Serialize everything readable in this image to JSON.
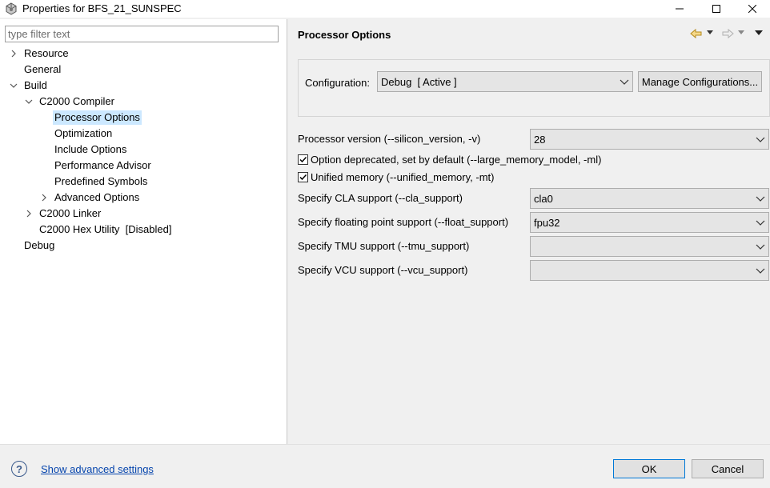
{
  "window": {
    "title": "Properties for BFS_21_SUNSPEC"
  },
  "filter": {
    "placeholder": "type filter text",
    "value": ""
  },
  "tree": [
    {
      "label": "Resource",
      "arrow": "right"
    },
    {
      "label": "General",
      "arrow": ""
    },
    {
      "label": "Build",
      "arrow": "down"
    },
    {
      "label": "C2000 Compiler",
      "arrow": "down"
    },
    {
      "label": "Processor Options",
      "arrow": "",
      "selected": true
    },
    {
      "label": "Optimization",
      "arrow": ""
    },
    {
      "label": "Include Options",
      "arrow": ""
    },
    {
      "label": "Performance Advisor",
      "arrow": ""
    },
    {
      "label": "Predefined Symbols",
      "arrow": ""
    },
    {
      "label": "Advanced Options",
      "arrow": "right"
    },
    {
      "label": "C2000 Linker",
      "arrow": "right"
    },
    {
      "label": "C2000 Hex Utility  [Disabled]",
      "arrow": ""
    },
    {
      "label": "Debug",
      "arrow": ""
    }
  ],
  "page": {
    "title": "Processor Options",
    "configuration_label": "Configuration:",
    "configuration_value": "Debug  [ Active ]",
    "manage_button": "Manage Configurations..."
  },
  "options": {
    "processor_version": {
      "label": "Processor version (--silicon_version, -v)",
      "value": "28"
    },
    "large_memory": {
      "label": "Option deprecated, set by default (--large_memory_model, -ml)",
      "checked": true
    },
    "unified_memory": {
      "label": "Unified memory (--unified_memory, -mt)",
      "checked": true
    },
    "cla_support": {
      "label": "Specify CLA support (--cla_support)",
      "value": "cla0"
    },
    "float_support": {
      "label": "Specify floating point support (--float_support)",
      "value": "fpu32"
    },
    "tmu_support": {
      "label": "Specify TMU support (--tmu_support)",
      "value": ""
    },
    "vcu_support": {
      "label": "Specify VCU support (--vcu_support)",
      "value": ""
    }
  },
  "footer": {
    "help_glyph": "?",
    "advanced_link": "Show advanced settings",
    "ok": "OK",
    "cancel": "Cancel"
  }
}
